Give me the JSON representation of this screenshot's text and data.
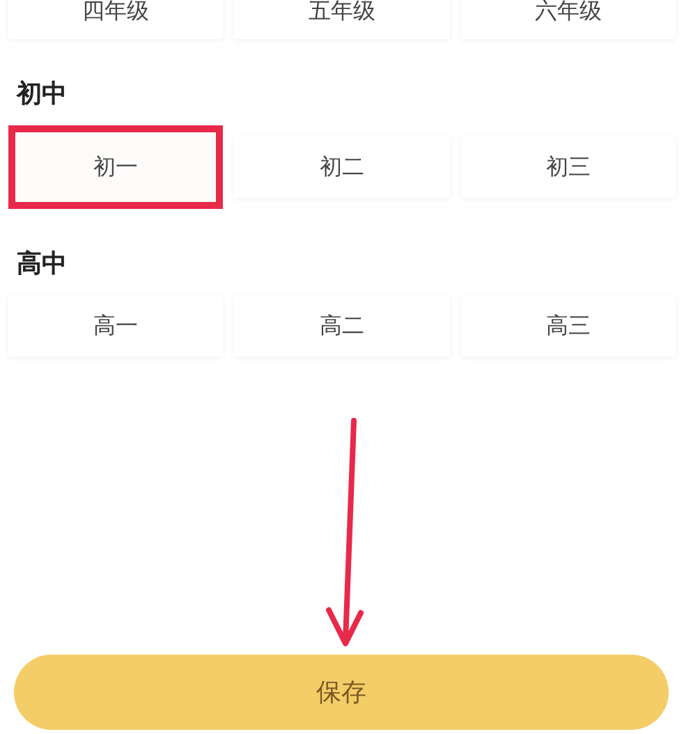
{
  "sections": [
    {
      "grades": [
        {
          "label": "四年级",
          "highlighted": false
        },
        {
          "label": "五年级",
          "highlighted": false
        },
        {
          "label": "六年级",
          "highlighted": false
        }
      ]
    },
    {
      "title": "初中",
      "grades": [
        {
          "label": "初一",
          "highlighted": true
        },
        {
          "label": "初二",
          "highlighted": false
        },
        {
          "label": "初三",
          "highlighted": false
        }
      ]
    },
    {
      "title": "高中",
      "grades": [
        {
          "label": "高一",
          "highlighted": false
        },
        {
          "label": "高二",
          "highlighted": false
        },
        {
          "label": "高三",
          "highlighted": false
        }
      ]
    }
  ],
  "save_button": "保存"
}
